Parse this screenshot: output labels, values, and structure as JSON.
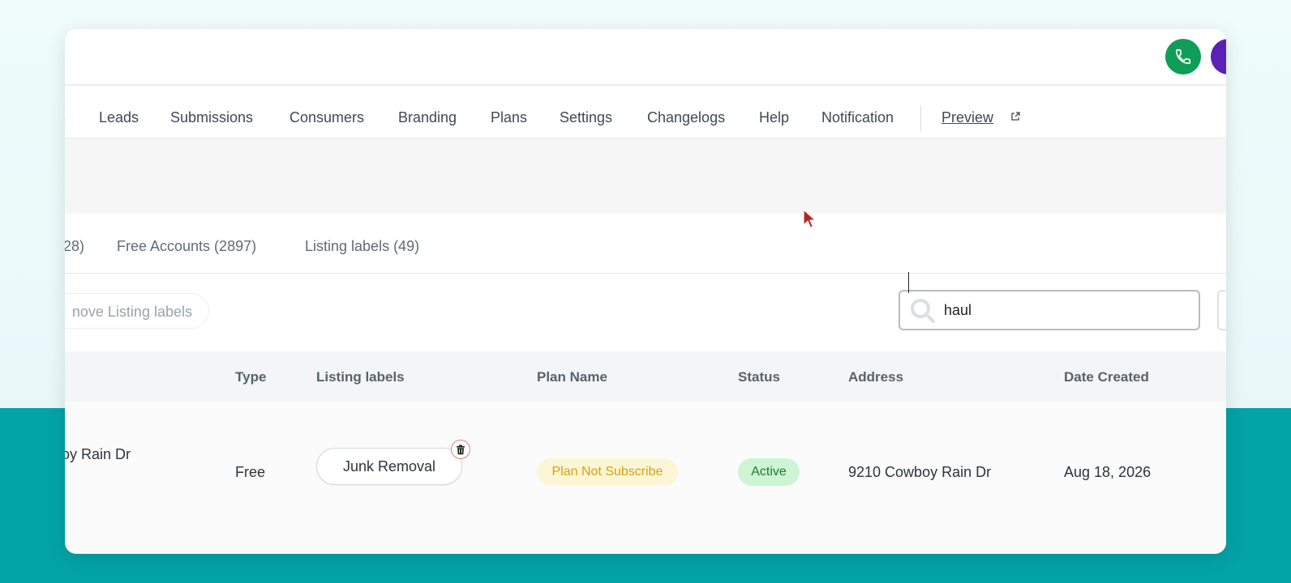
{
  "colors": {
    "accent": "#3ba8c4",
    "phone_green": "#0f9d58",
    "avatar_purple": "#5b21b6",
    "teal_background": "#03a4a6",
    "plan_badge_bg": "#fdf6d6",
    "plan_badge_text": "#d4a20f",
    "status_badge_bg": "#cdf5d3",
    "status_badge_text": "#1f7a2e"
  },
  "header": {
    "phone_icon": "phone-icon",
    "avatar_icon": "avatar"
  },
  "nav": {
    "items": [
      {
        "label": "s",
        "active": true
      },
      {
        "label": "Leads"
      },
      {
        "label": "Submissions"
      },
      {
        "label": "Consumers"
      },
      {
        "label": "Branding"
      },
      {
        "label": "Plans"
      },
      {
        "label": "Settings"
      },
      {
        "label": "Changelogs"
      },
      {
        "label": "Help"
      },
      {
        "label": "Notification"
      }
    ],
    "preview": {
      "label": "Preview",
      "icon": "external-link-icon"
    }
  },
  "tabs": [
    {
      "label": "28)"
    },
    {
      "label": "Free Accounts (2897)"
    },
    {
      "label": "Listing labels (49)"
    }
  ],
  "toolbar": {
    "remove_labels_button": "nove Listing labels",
    "search": {
      "value": "haul",
      "icon": "search-icon"
    }
  },
  "table": {
    "columns": [
      "Type",
      "Listing labels",
      "Plan Name",
      "Status",
      "Address",
      "Date Created"
    ],
    "rows": [
      {
        "name": "oy Rain Dr",
        "type": "Free",
        "listing_label": "Junk Removal",
        "remove_label_icon": "trash-icon",
        "plan_name": "Plan Not Subscribe",
        "status": "Active",
        "address": "9210 Cowboy Rain Dr",
        "date_created": "Aug 18, 2026"
      }
    ]
  }
}
